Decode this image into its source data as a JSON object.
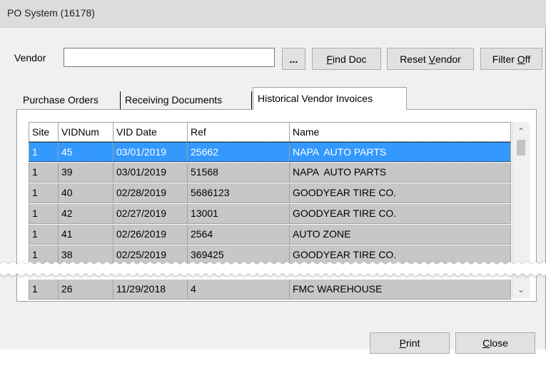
{
  "window": {
    "title": "PO System (16178)"
  },
  "vendor": {
    "label": "Vendor",
    "value": ""
  },
  "toolbar": {
    "ellipsis_label": "...",
    "find_doc": {
      "pre": "",
      "ul": "F",
      "post": "ind Doc"
    },
    "reset_vendor": {
      "pre": "Reset ",
      "ul": "V",
      "post": "endor"
    },
    "filter_off": {
      "pre": "Filter ",
      "ul": "O",
      "post": "ff"
    }
  },
  "tabs": [
    {
      "label": "Purchase Orders",
      "active": false
    },
    {
      "label": "Receiving Documents",
      "active": false
    },
    {
      "label": "Historical Vendor Invoices",
      "active": true
    }
  ],
  "table": {
    "columns": [
      "Site",
      "VIDNum",
      "VID Date",
      "Ref",
      "Name"
    ],
    "rows": [
      {
        "site": "1",
        "vidnum": "45",
        "date": "03/01/2019",
        "ref": "25662",
        "name": "NAPA  AUTO PARTS",
        "selected": true
      },
      {
        "site": "1",
        "vidnum": "39",
        "date": "03/01/2019",
        "ref": "51568",
        "name": "NAPA  AUTO PARTS"
      },
      {
        "site": "1",
        "vidnum": "40",
        "date": "02/28/2019",
        "ref": "5686123",
        "name": "GOODYEAR TIRE CO."
      },
      {
        "site": "1",
        "vidnum": "42",
        "date": "02/27/2019",
        "ref": "13001",
        "name": "GOODYEAR TIRE CO."
      },
      {
        "site": "1",
        "vidnum": "41",
        "date": "02/26/2019",
        "ref": "2564",
        "name": "AUTO ZONE"
      },
      {
        "site": "1",
        "vidnum": "38",
        "date": "02/25/2019",
        "ref": "369425",
        "name": "GOODYEAR TIRE CO."
      },
      {
        "site": "1",
        "vidnum": "26",
        "date": "11/29/2018",
        "ref": "4",
        "name": "FMC WAREHOUSE"
      }
    ]
  },
  "scrollbar": {
    "up_icon": "chevron-up-icon",
    "down_icon": "chevron-down-icon"
  },
  "footer": {
    "print": {
      "pre": "",
      "ul": "P",
      "post": "rint"
    },
    "close": {
      "pre": "",
      "ul": "C",
      "post": "lose"
    }
  },
  "colors": {
    "selection": "#3399ff",
    "row_fill": "#c7c7c7",
    "window_bg": "#f0f0f0"
  }
}
